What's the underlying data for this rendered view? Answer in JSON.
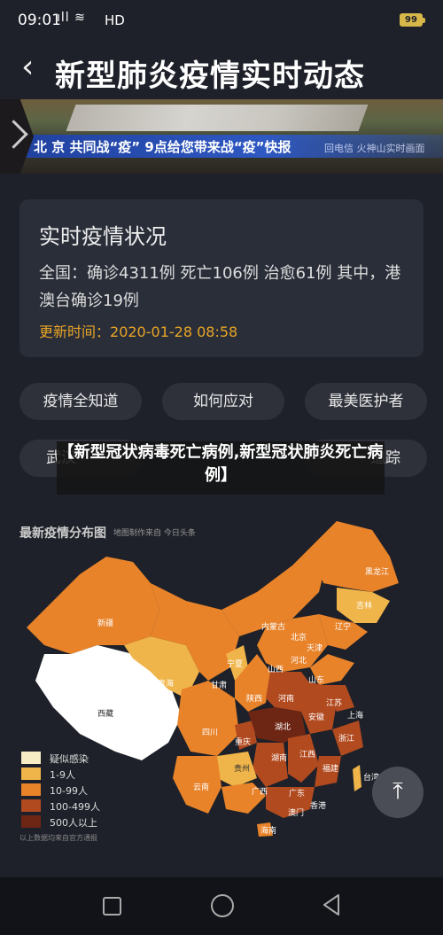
{
  "status_bar": {
    "time": "09:01",
    "signal_icons": "ıll ≋",
    "network": "HD",
    "battery": "99"
  },
  "header": {
    "back_icon": "chevron-left-icon",
    "title": "新型肺炎疫情实时动态"
  },
  "banner": {
    "headline": "北 京   共同战“疫”  9点给您带来战“疫”快报",
    "right_text": "回电信  火神山实时画面"
  },
  "status_card": {
    "title": "实时疫情状况",
    "summary": "全国：确诊4311例 死亡106例 治愈61例 其中，港澳台确诊19例",
    "update_label": "更新时间：",
    "update_time": "2020-01-28 08:58"
  },
  "buttons": {
    "row1": [
      "疫情全知道",
      "如何应对",
      "最美医护者"
    ],
    "row2_left": "武汉",
    "row2_right": "追踪"
  },
  "overlay_caption": "【新型冠状病毒死亡病例,新型冠状肺炎死亡病例】",
  "map": {
    "title": "最新疫情分布图",
    "source": "地图制作来自 今日头条",
    "provinces": [
      "黑龙江",
      "吉林",
      "辽宁",
      "内蒙古",
      "北京",
      "天津",
      "河北",
      "新疆",
      "青海",
      "宁夏",
      "甘肃",
      "山西",
      "山东",
      "西藏",
      "陕西",
      "河南",
      "江苏",
      "上海",
      "四川",
      "重庆",
      "湖北",
      "安徽",
      "浙江",
      "贵州",
      "湖南",
      "江西",
      "福建",
      "云南",
      "广西",
      "广东",
      "香港",
      "澳门",
      "海南",
      "台湾"
    ],
    "legend": [
      {
        "label": "疑似感染",
        "color": "#f8ecc4"
      },
      {
        "label": "1-9人",
        "color": "#f0b54a"
      },
      {
        "label": "10-99人",
        "color": "#e8832a"
      },
      {
        "label": "100-499人",
        "color": "#b24a1f"
      },
      {
        "label": "500人以上",
        "color": "#6e2614"
      }
    ],
    "note": "以上数据均来自官方通报"
  },
  "fab_icon": "scroll-to-top-icon",
  "nav": {
    "recents_icon": "square-icon",
    "home_icon": "circle-icon",
    "back_icon": "triangle-back-icon"
  }
}
